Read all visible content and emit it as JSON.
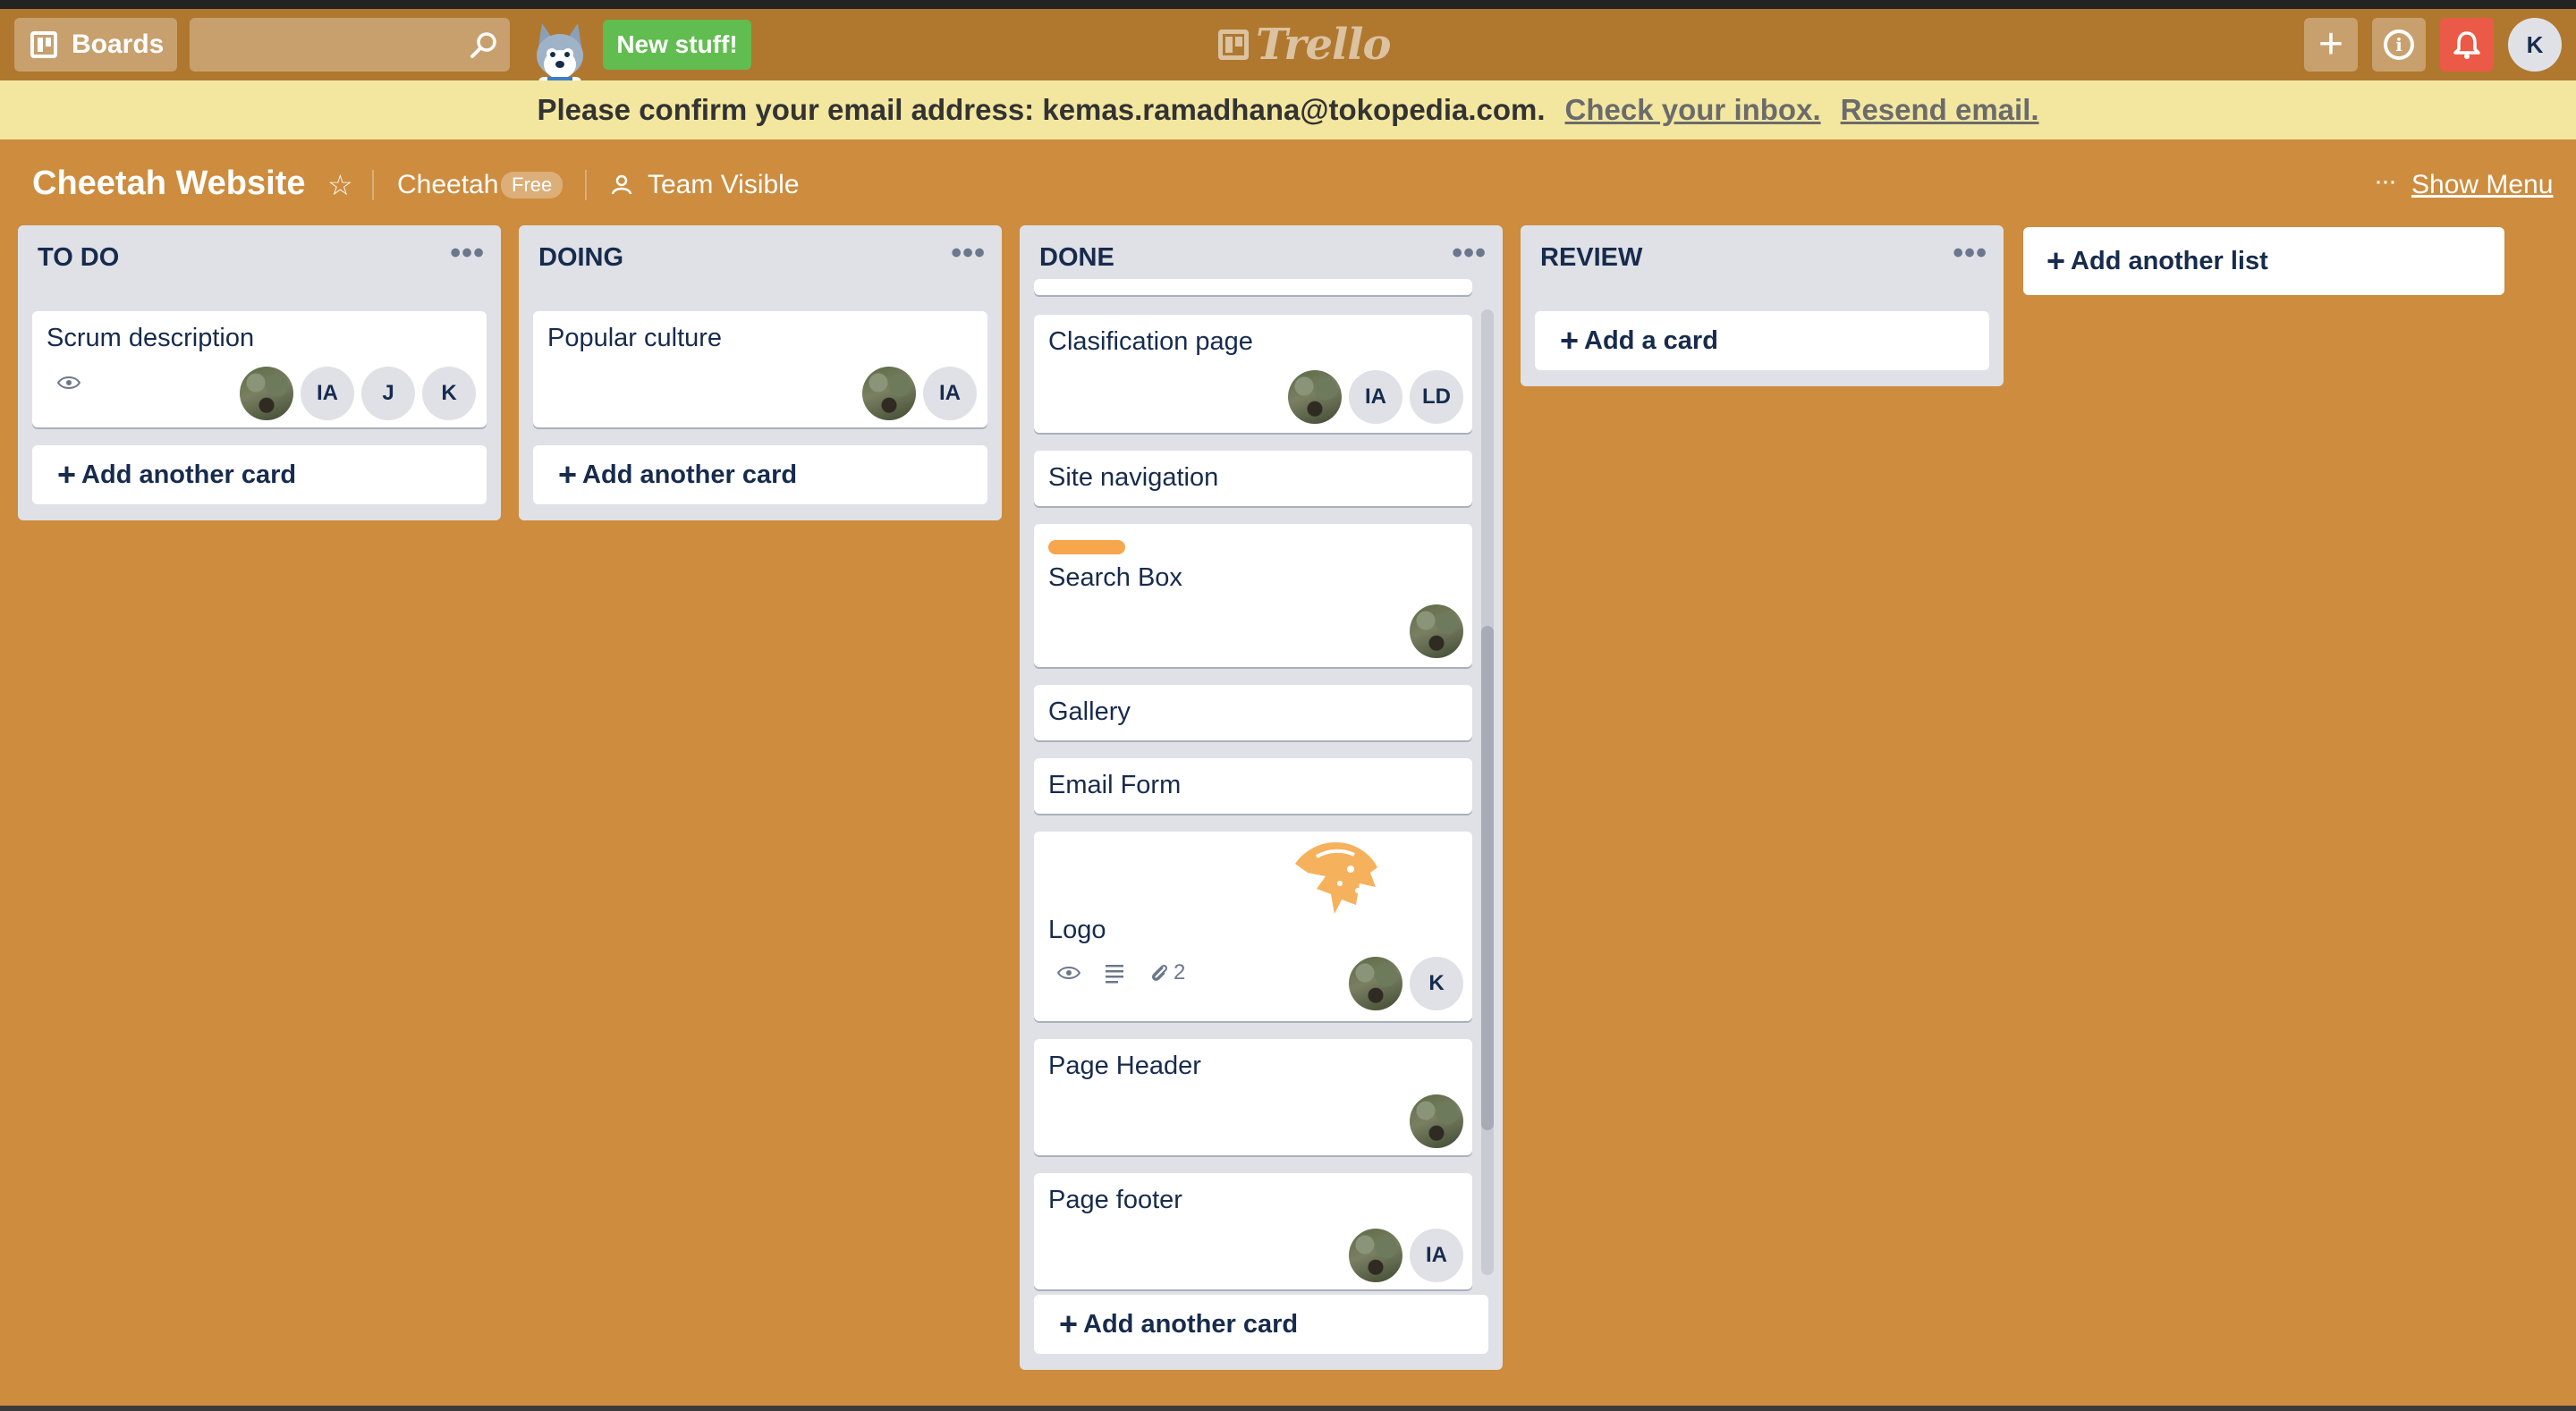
{
  "header": {
    "boards_label": "Boards",
    "search_placeholder": "",
    "new_stuff_label": "New stuff!",
    "logo_text": "Trello",
    "add_label": "+",
    "info_label": "i",
    "user_initial": "K"
  },
  "banner": {
    "message": "Please confirm your email address: kemas.ramadhana@tokopedia.com.",
    "check_inbox": "Check your inbox.",
    "resend": "Resend email."
  },
  "board": {
    "title": "Cheetah Website",
    "team": "Cheetah",
    "plan_badge": "Free",
    "visibility": "Team Visible",
    "show_menu": "Show Menu",
    "menu_dots": "···"
  },
  "colors": {
    "background": "#cd8c3e",
    "header": "#b0782e",
    "banner": "#f3e7a0",
    "new_stuff": "#61bd4f",
    "notification": "#eb5a46",
    "label_orange": "#f6a64c"
  },
  "lists": {
    "todo": {
      "title": "TO DO",
      "menu": "•••",
      "add_card": "Add another card",
      "cards": [
        {
          "title": "Scrum description",
          "members": [
            "IA",
            "J",
            "K"
          ]
        }
      ]
    },
    "doing": {
      "title": "DOING",
      "menu": "•••",
      "add_card": "Add another card",
      "cards": [
        {
          "title": "Popular culture",
          "members": [
            "IA"
          ]
        }
      ]
    },
    "done": {
      "title": "DONE",
      "menu": "•••",
      "add_card": "Add another card",
      "cards": [
        {
          "title": "Clasification page",
          "members": [
            "IA",
            "LD"
          ]
        },
        {
          "title": "Site navigation"
        },
        {
          "title": "Search Box",
          "label_color": "orange"
        },
        {
          "title": "Gallery"
        },
        {
          "title": "Email Form"
        },
        {
          "title": "Logo",
          "attachments": "2",
          "members": [
            "K"
          ]
        },
        {
          "title": "Page Header"
        },
        {
          "title": "Page footer",
          "members": [
            "IA"
          ]
        }
      ]
    },
    "review": {
      "title": "REVIEW",
      "menu": "•••",
      "add_card": "Add a card"
    },
    "add_list": "Add another list"
  },
  "icons": {
    "boards": "boards-icon",
    "search": "search-icon",
    "star": "star-icon",
    "visibility": "team-icon",
    "bell": "bell-icon",
    "info": "info-icon",
    "watch": "eye-icon",
    "description": "description-icon",
    "attachment": "paperclip-icon"
  }
}
